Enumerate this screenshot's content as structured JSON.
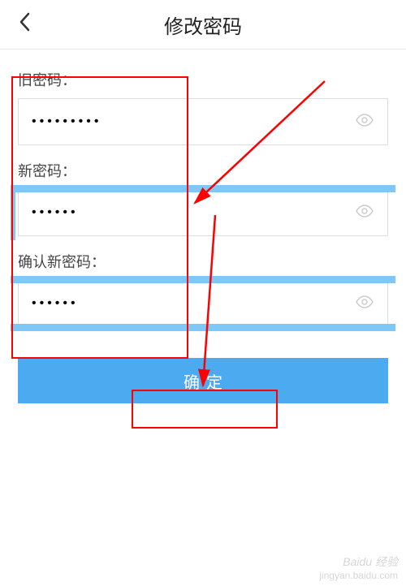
{
  "header": {
    "title": "修改密码"
  },
  "fields": {
    "old_password": {
      "label": "旧密码：",
      "value": "•••••••••"
    },
    "new_password": {
      "label": "新密码：",
      "value": "••••••"
    },
    "confirm_password": {
      "label": "确认新密码：",
      "value": "••••••"
    }
  },
  "button": {
    "confirm_label": "确定"
  },
  "watermark": {
    "brand": "Baidu 经验",
    "url": "jingyan.baidu.com"
  }
}
